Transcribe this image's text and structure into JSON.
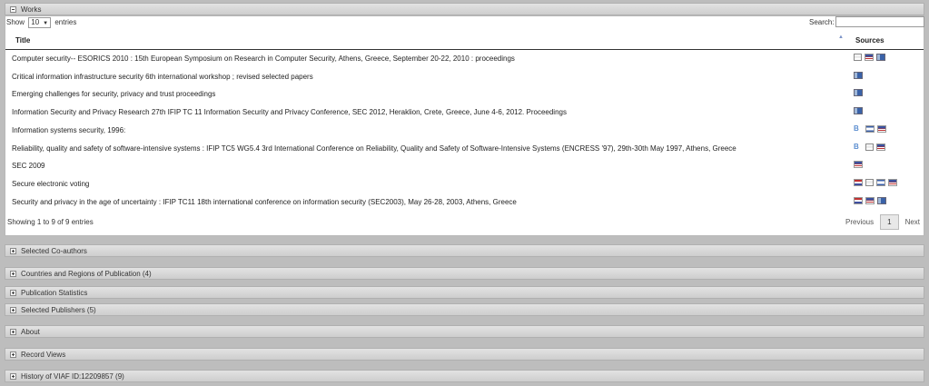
{
  "works": {
    "header": "Works",
    "show_label": "Show",
    "entries_value": "10",
    "entries_label": "entries",
    "search_label": "Search:",
    "search_value": "",
    "col_title": "Title",
    "col_sources": "Sources",
    "sort_icon": "▲",
    "rows": [
      {
        "title": "Computer security-- ESORICS 2010 : 15th European Symposium on Research in Computer Security, Athens, Greece, September 20-22, 2010 : proceedings",
        "sources": [
          "doc-icon",
          "us-flag-icon",
          "greece-flag-icon"
        ]
      },
      {
        "title": "Critical information infrastructure security 6th international workshop ; revised selected papers",
        "sources": [
          "greece-flag-icon"
        ]
      },
      {
        "title": "Emerging challenges for security, privacy and trust proceedings",
        "sources": [
          "greece-flag-icon"
        ]
      },
      {
        "title": "Information Security and Privacy Research 27th IFIP TC 11 Information Security and Privacy Conference, SEC 2012, Heraklion, Crete, Greece, June 4-6, 2012. Proceedings",
        "sources": [
          "greece-flag-icon"
        ]
      },
      {
        "title": "Information systems security, 1996:",
        "sources": [
          "b-icon",
          "mx-flag-icon",
          "us-flag-icon"
        ]
      },
      {
        "title": "Reliability, quality and safety of software-intensive systems : IFIP TC5 WG5.4 3rd International Conference on Reliability, Quality and Safety of Software-Intensive Systems (ENCRESS '97), 29th-30th May 1997, Athens, Greece",
        "sources": [
          "b-icon",
          "doc-icon",
          "us-flag-icon"
        ]
      },
      {
        "title": "SEC 2009",
        "sources": [
          "us-flag-icon"
        ]
      },
      {
        "title": "Secure electronic voting",
        "sources": [
          "nl-flag-icon",
          "doc-icon",
          "mx-flag-icon",
          "us-flag-icon"
        ]
      },
      {
        "title": "Security and privacy in the age of uncertainty : IFIP TC11 18th international conference on information security (SEC2003), May 26-28, 2003, Athens, Greece",
        "sources": [
          "nl-flag-icon",
          "us-flag-icon",
          "greece-flag-icon"
        ]
      }
    ],
    "info": "Showing 1 to 9 of 9 entries",
    "prev": "Previous",
    "page": "1",
    "next": "Next"
  },
  "sections": [
    "Selected Co-authors",
    "Countries and Regions of Publication (4)",
    "Publication Statistics",
    "Selected Publishers (5)",
    "About",
    "Record Views",
    "History of VIAF ID:12209857 (9)"
  ]
}
